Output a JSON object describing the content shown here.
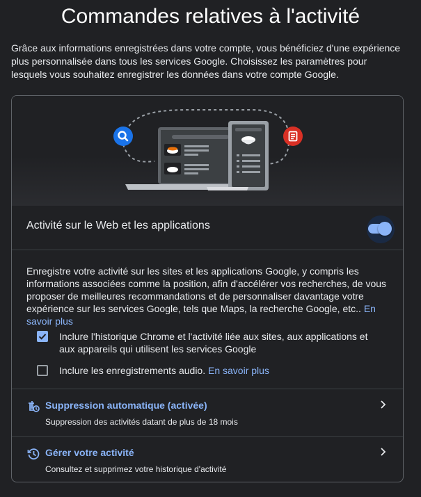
{
  "page": {
    "title": "Commandes relatives à l'activité",
    "intro": "Grâce aux informations enregistrées dans votre compte, vous bénéficiez d'une expérience plus personnalisée dans tous les services Google. Choisissez les paramètres pour lesquels vous souhaitez enregistrer les données dans votre compte Google."
  },
  "web_activity": {
    "title": "Activité sur le Web et les applications",
    "toggle_on": true,
    "description": "Enregistre votre activité sur les sites et les applications Google, y compris les informations associées comme la position, afin d'accélérer vos recherches, de vous proposer de meilleures recommandations et de personnaliser davantage votre expérience sur les services Google, tels que Maps, la recherche Google, etc..",
    "learn_more": "En savoir plus",
    "option_chrome": "Inclure l'historique Chrome et l'activité liée aux sites, aux applications et aux appareils qui utilisent les services Google",
    "option_chrome_checked": true,
    "option_audio": "Inclure les enregistrements audio.",
    "option_audio_checked": false,
    "audio_learn_more": "En savoir plus"
  },
  "auto_delete": {
    "title": "Suppression automatique (activée)",
    "subtitle": "Suppression des activités datant de plus de 18 mois"
  },
  "manage": {
    "title": "Gérer votre activité",
    "subtitle": "Consultez et supprimez votre historique d'activité"
  },
  "colors": {
    "background": "#202124",
    "accent": "#8ab4f8",
    "search_badge": "#1a73e8",
    "doc_badge": "#d93025"
  },
  "icons": {
    "search_badge": "search-icon",
    "doc_badge": "document-icon",
    "auto_delete": "auto-delete-icon",
    "manage": "history-icon",
    "row_arrow": "chevron-right-icon",
    "checkbox": "check-icon"
  }
}
